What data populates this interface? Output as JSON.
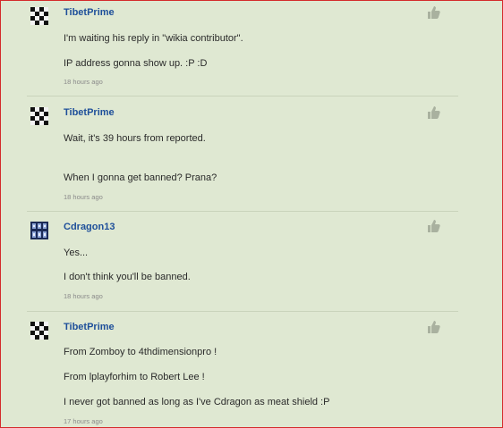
{
  "comments": [
    {
      "author": "TibetPrime",
      "avatar": "checker-avatar",
      "lines": [
        "I'm waiting his reply in \"wikia contributor\".",
        "IP address gonna show up.  :P :D"
      ],
      "time": "18 hours ago"
    },
    {
      "author": "TibetPrime",
      "avatar": "checker-avatar",
      "lines": [
        "Wait, it's 39 hours from reported.",
        "When I gonna get banned? Prana?"
      ],
      "time": "18 hours ago"
    },
    {
      "author": "Cdragon13",
      "avatar": "dragon-avatar",
      "lines": [
        "Yes...",
        "I don't think you'll be banned."
      ],
      "time": "18 hours ago"
    },
    {
      "author": "TibetPrime",
      "avatar": "checker-avatar",
      "lines": [
        "From Zomboy to 4thdimensionpro !",
        "From lplayforhim to Robert Lee !",
        "I never got banned as long as I've Cdragon as meat shield :P"
      ],
      "time": "17 hours ago"
    }
  ],
  "icons": {
    "like": "thumbs-up-icon"
  },
  "colors": {
    "background": "#dfe8d2",
    "author": "#1e4f9a",
    "frame": "#d42b2b"
  }
}
